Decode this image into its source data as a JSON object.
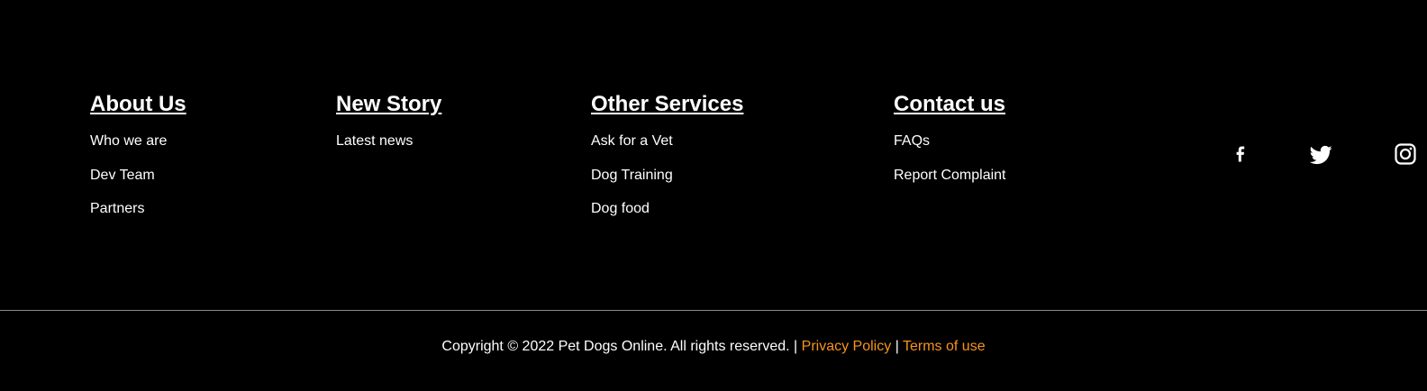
{
  "colors": {
    "background": "#000000",
    "text": "#ffffff",
    "link_accent": "#f7931e",
    "divider": "#8a8a8a"
  },
  "footer": {
    "columns": [
      {
        "heading": "About Us",
        "links": [
          "Who we are",
          "Dev Team",
          "Partners"
        ]
      },
      {
        "heading": "New Story",
        "links": [
          "Latest news"
        ]
      },
      {
        "heading": "Other Services",
        "links": [
          "Ask for a Vet",
          "Dog Training",
          "Dog food"
        ]
      },
      {
        "heading": "Contact us",
        "links": [
          "FAQs",
          "Report Complaint"
        ]
      }
    ],
    "social": [
      {
        "name": "facebook-icon"
      },
      {
        "name": "twitter-icon"
      },
      {
        "name": "instagram-icon"
      }
    ],
    "copyright": {
      "text": "Copyright © 2022 Pet Dogs Online. All rights reserved.",
      "separator": "|",
      "privacy_label": "Privacy Policy",
      "terms_label": "Terms of use"
    }
  }
}
